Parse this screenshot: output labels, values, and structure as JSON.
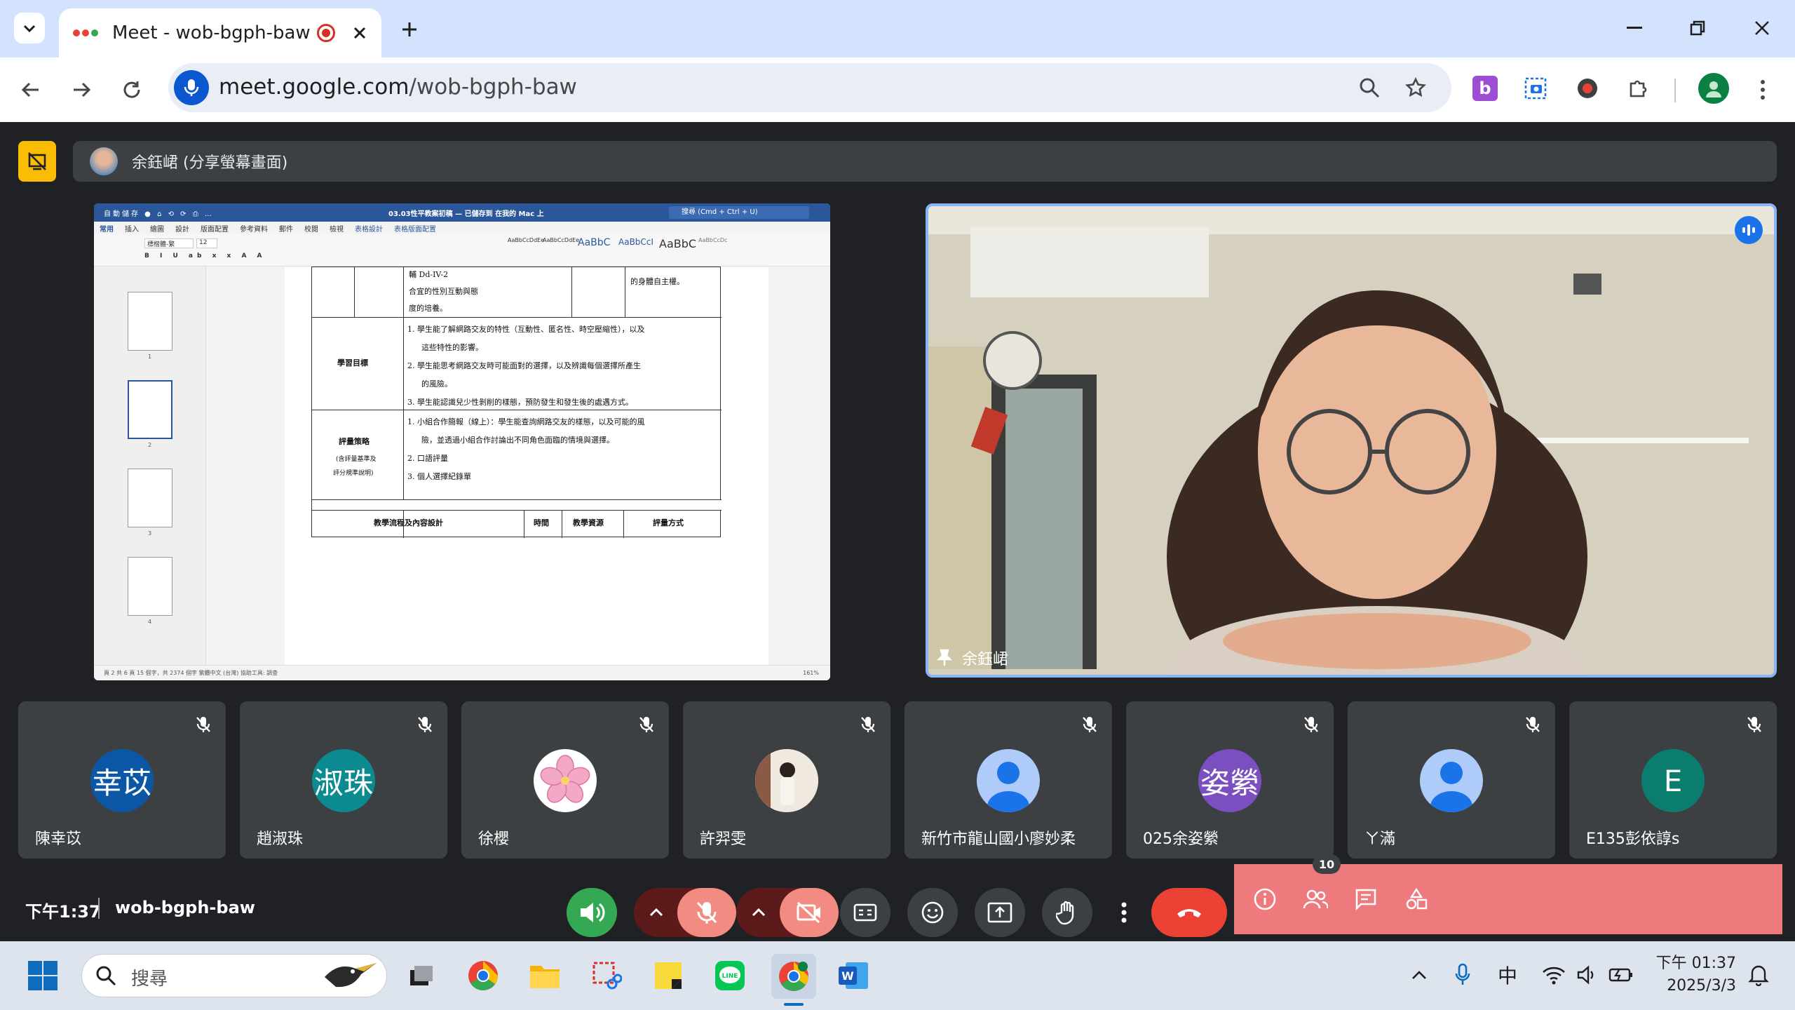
{
  "browser": {
    "tab_title": "Meet - wob-bgph-baw",
    "url_domain": "meet.google.com",
    "url_path": "/wob-bgph-baw"
  },
  "meeting": {
    "presenter_label": "余鈺峮 (分享螢幕畫面)",
    "camera_name": "余鈺峮",
    "time": "下午1:37",
    "code": "wob-bgph-baw",
    "participant_count": "10"
  },
  "participants": [
    {
      "name": "陳幸苡",
      "initials": "幸苡",
      "color": "#0b57a6"
    },
    {
      "name": "趙淑珠",
      "initials": "淑珠",
      "color": "#0b8a8f"
    },
    {
      "name": "徐櫻",
      "initials": "",
      "color": "#ffffff"
    },
    {
      "name": "許羿雯",
      "initials": "",
      "color": "#f1eee8"
    },
    {
      "name": "新竹市龍山國小廖妙柔",
      "initials": "",
      "color": "#aecbfa"
    },
    {
      "name": "025余姿縈",
      "initials": "姿縈",
      "color": "#7b4fbf"
    },
    {
      "name": "ㄚ滿",
      "initials": "",
      "color": "#aecbfa"
    },
    {
      "name": "E135彭依諄s",
      "initials": "E",
      "color": "#0b7d6e"
    }
  ],
  "document": {
    "title": "03.03性平教案初稿 — 已儲存到 在我的 Mac 上",
    "search_placeholder": "搜尋 (Cmd + Ctrl + U)",
    "menu": [
      "常用",
      "插入",
      "繪圖",
      "設計",
      "版面配置",
      "參考資料",
      "郵件",
      "校閱",
      "檢視",
      "表格設計",
      "表格版面配置"
    ],
    "styles": [
      "AaBbCcDdEe",
      "AaBbCcDdEe",
      "AaBbC",
      "AaBbCcI",
      "AaBbC",
      "AaBbCcDc"
    ],
    "font_name": "標楷體-繁",
    "font_size": "12",
    "rows": {
      "top_code": "輔 Dd-IV-2",
      "top_line2": "合宜的性別互動與態",
      "top_line3": "度的培養。",
      "top_right": "的身體自主權。",
      "goal_label": "學習目標",
      "goal_1": "1.  學生能了解網路交友的特性（互動性、匿名性、時空壓縮性），以及",
      "goal_1b": "這些特性的影響。",
      "goal_2": "2.  學生能思考網路交友時可能面對的選擇，以及辨識每個選擇所產生",
      "goal_2b": "的風險。",
      "goal_3": "3.  學生能認識兒少性剝削的樣態，預防發生和發生後的處遇方式。",
      "eval_label": "評量策略",
      "eval_sub1": "(含評量基準及",
      "eval_sub2": "評分規準說明)",
      "eval_1": "1.  小組合作簡報（線上）：學生能查詢網路交友的樣態，以及可能的風",
      "eval_1b": "險，並透過小組合作討論出不同角色面臨的情境與選擇。",
      "eval_2": "2.  口語評量",
      "eval_3": "3.  個人選擇紀錄單",
      "foot_1": "教學流程及內容設計",
      "foot_2": "時間",
      "foot_3": "教學資源",
      "foot_4": "評量方式"
    },
    "status": "頁 2 共 6 頁    15 個字，共 2374 個字    繁體中文 (台灣)    協助工具: 調查",
    "zoom": "161%",
    "thumb_numbers": [
      "1",
      "2",
      "3",
      "4"
    ]
  },
  "taskbar": {
    "search_placeholder": "搜尋",
    "ime": "中",
    "clock_time": "下午 01:37",
    "clock_date": "2025/3/3"
  },
  "colors": {
    "tab_strip": "#d3e3fd",
    "meet_bg": "#202124",
    "tile_bg": "#3c4043",
    "end_call": "#ea4335",
    "accent_blue": "#8ab4f8"
  }
}
